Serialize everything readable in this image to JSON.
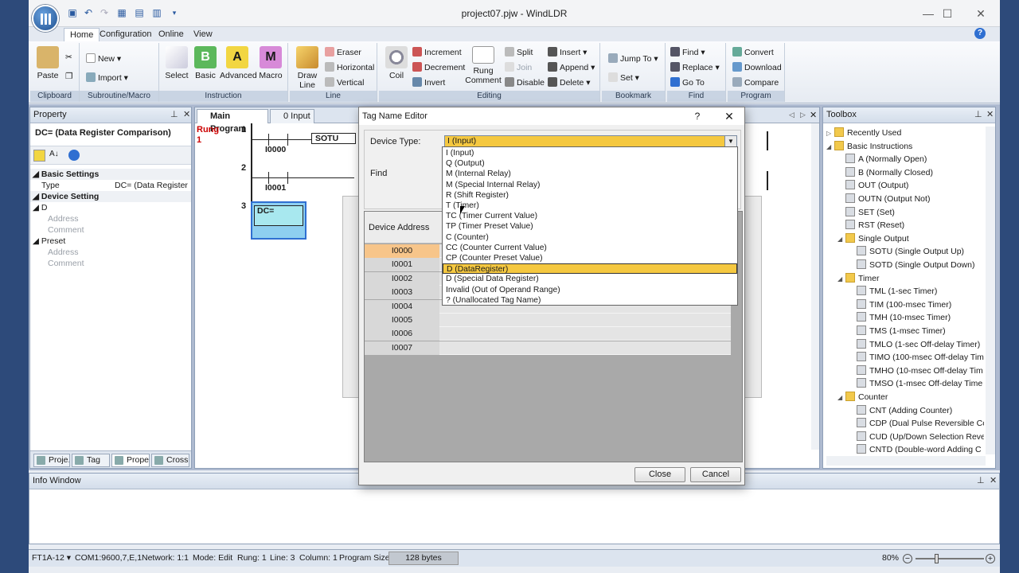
{
  "window": {
    "title": "project07.pjw - WindLDR",
    "min": "—",
    "max": "☐",
    "close": "✕"
  },
  "menu": {
    "tabs": [
      "Home",
      "Configuration",
      "Online",
      "View"
    ],
    "help": "?"
  },
  "ribbon": {
    "clipboard": {
      "label": "Clipboard",
      "paste": "Paste"
    },
    "subroutine": {
      "label": "Subroutine/Macro",
      "new": "New",
      "import": "Import"
    },
    "instruction": {
      "label": "Instruction",
      "select": "Select",
      "basic": "Basic",
      "advanced": "Advanced",
      "macro": "Macro"
    },
    "line": {
      "label": "Line",
      "draw": "Draw Line",
      "eraser": "Eraser",
      "horizontal": "Horizontal",
      "vertical": "Vertical"
    },
    "editing": {
      "label": "Editing",
      "coil": "Coil",
      "increment": "Increment",
      "decrement": "Decrement",
      "invert": "Invert",
      "rung_comment": "Rung Comment",
      "split": "Split",
      "join": "Join",
      "disable": "Disable",
      "insert": "Insert",
      "append": "Append",
      "delete": "Delete"
    },
    "bookmark": {
      "label": "Bookmark",
      "jump_to": "Jump To",
      "set": "Set"
    },
    "find": {
      "label": "Find",
      "find": "Find",
      "replace": "Replace",
      "go_to": "Go To"
    },
    "program": {
      "label": "Program",
      "convert": "Convert",
      "download": "Download",
      "compare": "Compare"
    }
  },
  "property": {
    "header": "Property",
    "title": "DC= (Data Register Comparison)",
    "rows": {
      "basic_settings": "Basic Settings",
      "type_label": "Type",
      "type_value": "DC= (Data Register",
      "device_setting": "Device Setting",
      "d": "D",
      "address1": "Address",
      "comment1": "Comment",
      "preset": "Preset",
      "address2": "Address",
      "comment2": "Comment"
    },
    "tabs": [
      "Proje...",
      "Tag E...",
      "Prope...",
      "Cross..."
    ]
  },
  "editor": {
    "tabs": [
      "Main Program",
      "0 Input"
    ],
    "rung_label": "Rung",
    "rung_number": "1",
    "rungs": [
      {
        "num": "1",
        "contact": "I0000",
        "output": "SOTU"
      },
      {
        "num": "2",
        "contact": "I0001"
      },
      {
        "num": "3",
        "block": "DC="
      }
    ]
  },
  "toolbox": {
    "header": "Toolbox",
    "items": [
      {
        "label": "Recently Used",
        "level": 0,
        "folder": true,
        "exp": "▷"
      },
      {
        "label": "Basic Instructions",
        "level": 0,
        "folder": true,
        "exp": "◢"
      },
      {
        "label": "A (Normally Open)",
        "level": 1
      },
      {
        "label": "B (Normally Closed)",
        "level": 1
      },
      {
        "label": "OUT (Output)",
        "level": 1
      },
      {
        "label": "OUTN (Output Not)",
        "level": 1
      },
      {
        "label": "SET (Set)",
        "level": 1
      },
      {
        "label": "RST (Reset)",
        "level": 1
      },
      {
        "label": "Single Output",
        "level": 1,
        "folder": true,
        "exp": "◢"
      },
      {
        "label": "SOTU (Single Output Up)",
        "level": 2
      },
      {
        "label": "SOTD (Single Output Down)",
        "level": 2
      },
      {
        "label": "Timer",
        "level": 1,
        "folder": true,
        "exp": "◢"
      },
      {
        "label": "TML (1-sec Timer)",
        "level": 2
      },
      {
        "label": "TIM (100-msec Timer)",
        "level": 2
      },
      {
        "label": "TMH (10-msec Timer)",
        "level": 2
      },
      {
        "label": "TMS (1-msec Timer)",
        "level": 2
      },
      {
        "label": "TMLO (1-sec Off-delay Timer)",
        "level": 2
      },
      {
        "label": "TIMO (100-msec Off-delay Tim",
        "level": 2
      },
      {
        "label": "TMHO (10-msec Off-delay Tim",
        "level": 2
      },
      {
        "label": "TMSO (1-msec Off-delay Time",
        "level": 2
      },
      {
        "label": "Counter",
        "level": 1,
        "folder": true,
        "exp": "◢"
      },
      {
        "label": "CNT (Adding Counter)",
        "level": 2
      },
      {
        "label": "CDP (Dual Pulse Reversible Co",
        "level": 2
      },
      {
        "label": "CUD (Up/Down Selection Reve",
        "level": 2
      },
      {
        "label": "CNTD (Double-word Adding C",
        "level": 2
      }
    ]
  },
  "info": {
    "header": "Info Window"
  },
  "status": {
    "plc": "FT1A-12",
    "com": "COM1:9600,7,E,1",
    "network": "Network: 1:1",
    "mode": "Mode: Edit",
    "rung": "Rung: 1",
    "line": "Line: 3",
    "column": "Column: 1",
    "program_size_label": "Program Size:",
    "program_size": "128 bytes",
    "zoom": "80%"
  },
  "dialog": {
    "title": "Tag Name Editor",
    "help": "?",
    "close_x": "✕",
    "device_type_label": "Device Type:",
    "device_type_value": "I (Input)",
    "find_label": "Find",
    "col_device_address": "Device Address",
    "rows": [
      "I0000",
      "I0001",
      "I0002",
      "I0003",
      "I0004",
      "I0005",
      "I0006",
      "I0007"
    ],
    "close_button": "Close",
    "cancel_button": "Cancel"
  },
  "dropdown": {
    "options": [
      "I (Input)",
      "Q (Output)",
      "M (Internal Relay)",
      "M (Special Internal Relay)",
      "R (Shift Register)",
      "T (Timer)",
      "TC (Timer Current Value)",
      "TP (Timer Preset Value)",
      "C (Counter)",
      "CC (Counter Current Value)",
      "CP (Counter Preset Value)",
      "D (DataRegister)",
      "D (Special Data Register)",
      "Invalid (Out of Operand Range)",
      "? (Unallocated Tag Name)"
    ],
    "highlighted_index": 11
  },
  "colors": {
    "highlight": "#f5c840",
    "selected_row": "#f7c58a",
    "accent": "#2f6fd1"
  }
}
